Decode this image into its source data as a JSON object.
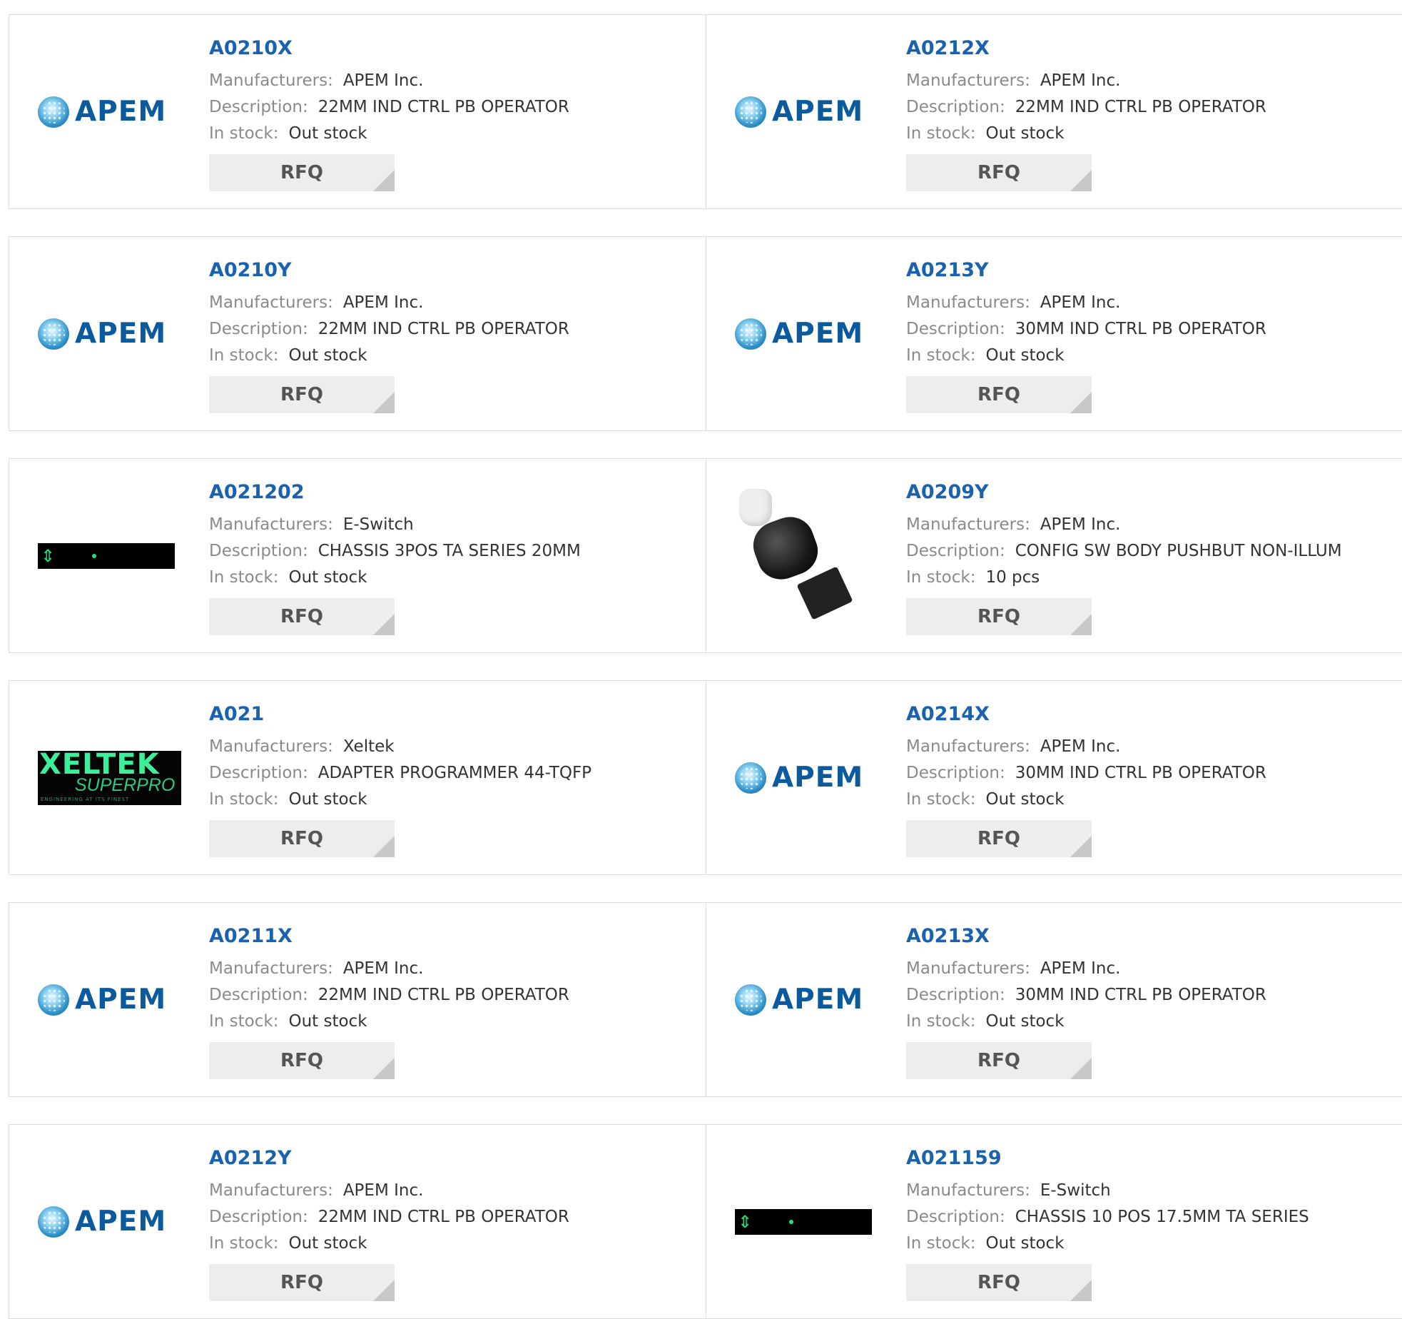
{
  "brand_logos": {
    "apem": "APEM",
    "xeltek_main": "XELTEK",
    "xeltek_sub": "SUPERPRO",
    "xeltek_tagline": "ENGINEERING AT ITS FINEST"
  },
  "labels": {
    "manufacturers": "Manufacturers:",
    "description": "Description:",
    "in_stock": "In stock:",
    "rfq": "RFQ"
  },
  "colors": {
    "part_link": "#1a62ae",
    "label": "#8a8a8a",
    "value": "#333333",
    "button_bg": "#ededed"
  },
  "rows": [
    [
      {
        "part": "A0210X",
        "logo": "apem-logo",
        "manufacturer": "APEM Inc.",
        "description": "22MM IND CTRL PB OPERATOR",
        "stock": "Out stock"
      },
      {
        "part": "A0212X",
        "logo": "apem-logo",
        "manufacturer": "APEM Inc.",
        "description": "22MM IND CTRL PB OPERATOR",
        "stock": "Out stock"
      }
    ],
    [
      {
        "part": "A0210Y",
        "logo": "apem-logo",
        "manufacturer": "APEM Inc.",
        "description": "22MM IND CTRL PB OPERATOR",
        "stock": "Out stock"
      },
      {
        "part": "A0213Y",
        "logo": "apem-logo",
        "manufacturer": "APEM Inc.",
        "description": "30MM IND CTRL PB OPERATOR",
        "stock": "Out stock"
      }
    ],
    [
      {
        "part": "A021202",
        "logo": "e-switch-logo",
        "manufacturer": "E-Switch",
        "description": "CHASSIS 3POS TA SERIES 20MM",
        "stock": "Out stock"
      },
      {
        "part": "A0209Y",
        "logo": "pushbutton-photo",
        "manufacturer": "APEM Inc.",
        "description": "CONFIG SW BODY PUSHBUT NON-ILLUM",
        "stock": "10 pcs"
      }
    ],
    [
      {
        "part": "A021",
        "logo": "xeltek-logo",
        "manufacturer": "Xeltek",
        "description": "ADAPTER PROGRAMMER 44-TQFP",
        "stock": "Out stock"
      },
      {
        "part": "A0214X",
        "logo": "apem-logo",
        "manufacturer": "APEM Inc.",
        "description": "30MM IND CTRL PB OPERATOR",
        "stock": "Out stock"
      }
    ],
    [
      {
        "part": "A0211X",
        "logo": "apem-logo",
        "manufacturer": "APEM Inc.",
        "description": "22MM IND CTRL PB OPERATOR",
        "stock": "Out stock"
      },
      {
        "part": "A0213X",
        "logo": "apem-logo",
        "manufacturer": "APEM Inc.",
        "description": "30MM IND CTRL PB OPERATOR",
        "stock": "Out stock"
      }
    ],
    [
      {
        "part": "A0212Y",
        "logo": "apem-logo",
        "manufacturer": "APEM Inc.",
        "description": "22MM IND CTRL PB OPERATOR",
        "stock": "Out stock"
      },
      {
        "part": "A021159",
        "logo": "e-switch-logo",
        "manufacturer": "E-Switch",
        "description": "CHASSIS 10 POS 17.5MM TA SERIES",
        "stock": "Out stock"
      }
    ]
  ]
}
